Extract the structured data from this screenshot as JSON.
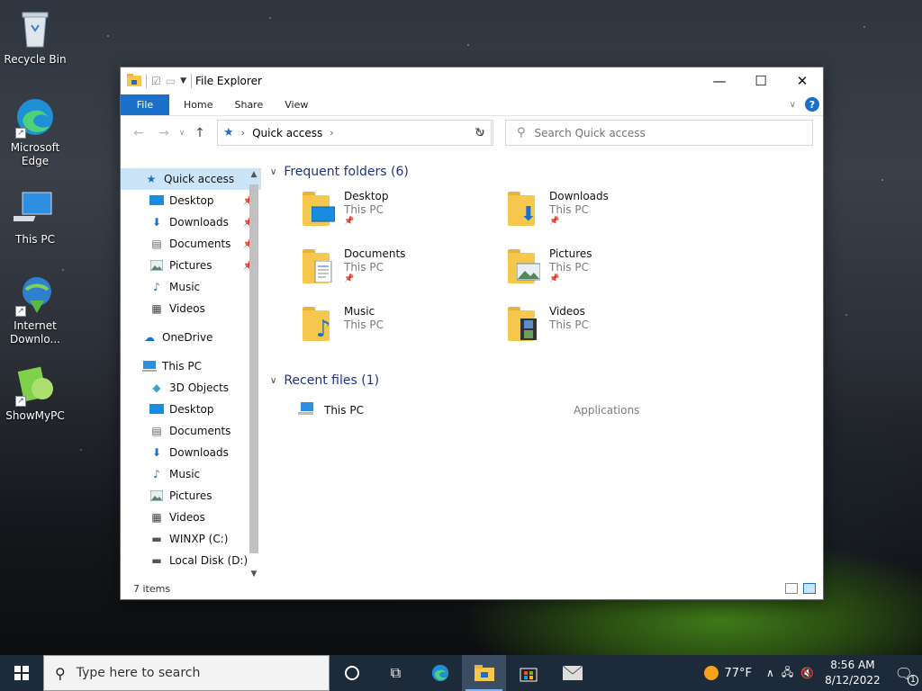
{
  "desktop": {
    "icons": [
      {
        "label": "Recycle Bin"
      },
      {
        "label": "Microsoft Edge"
      },
      {
        "label": "This PC"
      },
      {
        "label": "Internet Downlo..."
      },
      {
        "label": "ShowMyPC"
      }
    ]
  },
  "window": {
    "title": "File Explorer",
    "ribbon_tabs": [
      "File",
      "Home",
      "Share",
      "View"
    ],
    "address": {
      "location": "Quick access"
    },
    "search": {
      "placeholder": "Search Quick access"
    },
    "nav": {
      "quick_access": "Quick access",
      "quick_items": [
        "Desktop",
        "Downloads",
        "Documents",
        "Pictures",
        "Music",
        "Videos"
      ],
      "onedrive": "OneDrive",
      "this_pc": "This PC",
      "pc_items": [
        "3D Objects",
        "Desktop",
        "Documents",
        "Downloads",
        "Music",
        "Pictures",
        "Videos",
        "WINXP (C:)",
        "Local Disk (D:)"
      ]
    },
    "frequent": {
      "header": "Frequent folders (6)",
      "folders": [
        {
          "name": "Desktop",
          "location": "This PC"
        },
        {
          "name": "Downloads",
          "location": "This PC"
        },
        {
          "name": "Documents",
          "location": "This PC"
        },
        {
          "name": "Pictures",
          "location": "This PC"
        },
        {
          "name": "Music",
          "location": "This PC"
        },
        {
          "name": "Videos",
          "location": "This PC"
        }
      ]
    },
    "recent": {
      "header": "Recent files (1)",
      "files": [
        {
          "name": "This PC",
          "location": "Applications"
        }
      ]
    },
    "status": {
      "item_count": "7 items"
    }
  },
  "taskbar": {
    "search_placeholder": "Type here to search",
    "weather": "77°F",
    "time": "8:56 AM",
    "date": "8/12/2022",
    "notification_count": "1"
  }
}
